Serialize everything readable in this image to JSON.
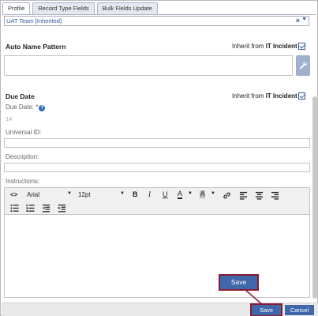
{
  "tabs": [
    {
      "label": "Profile"
    },
    {
      "label": "Record Type Fields"
    },
    {
      "label": "Bulk Fields Update"
    }
  ],
  "team_select": {
    "value": "UAT Team [Inherited]"
  },
  "auto_name": {
    "title": "Auto Name Pattern",
    "inherit_prefix": "Inherit from ",
    "inherit_source": "IT Incident",
    "inherit_checked": true
  },
  "due_date": {
    "title": "Due Date",
    "inherit_prefix": "Inherit from ",
    "inherit_source": "IT Incident",
    "inherit_checked": true,
    "label": "Due Date: *",
    "value": "14"
  },
  "fields": {
    "universal_id_label": "Universal ID:",
    "description_label": "Description:",
    "instructions_label": "Instructions:"
  },
  "editor": {
    "font": "Arial",
    "size": "12pt"
  },
  "buttons": {
    "callout_save": "Save",
    "save": "Save",
    "cancel": "Cancel"
  },
  "colors": {
    "accent": "#3f67a9",
    "highlight": "#8b1a33",
    "link": "#2d5c9d"
  }
}
